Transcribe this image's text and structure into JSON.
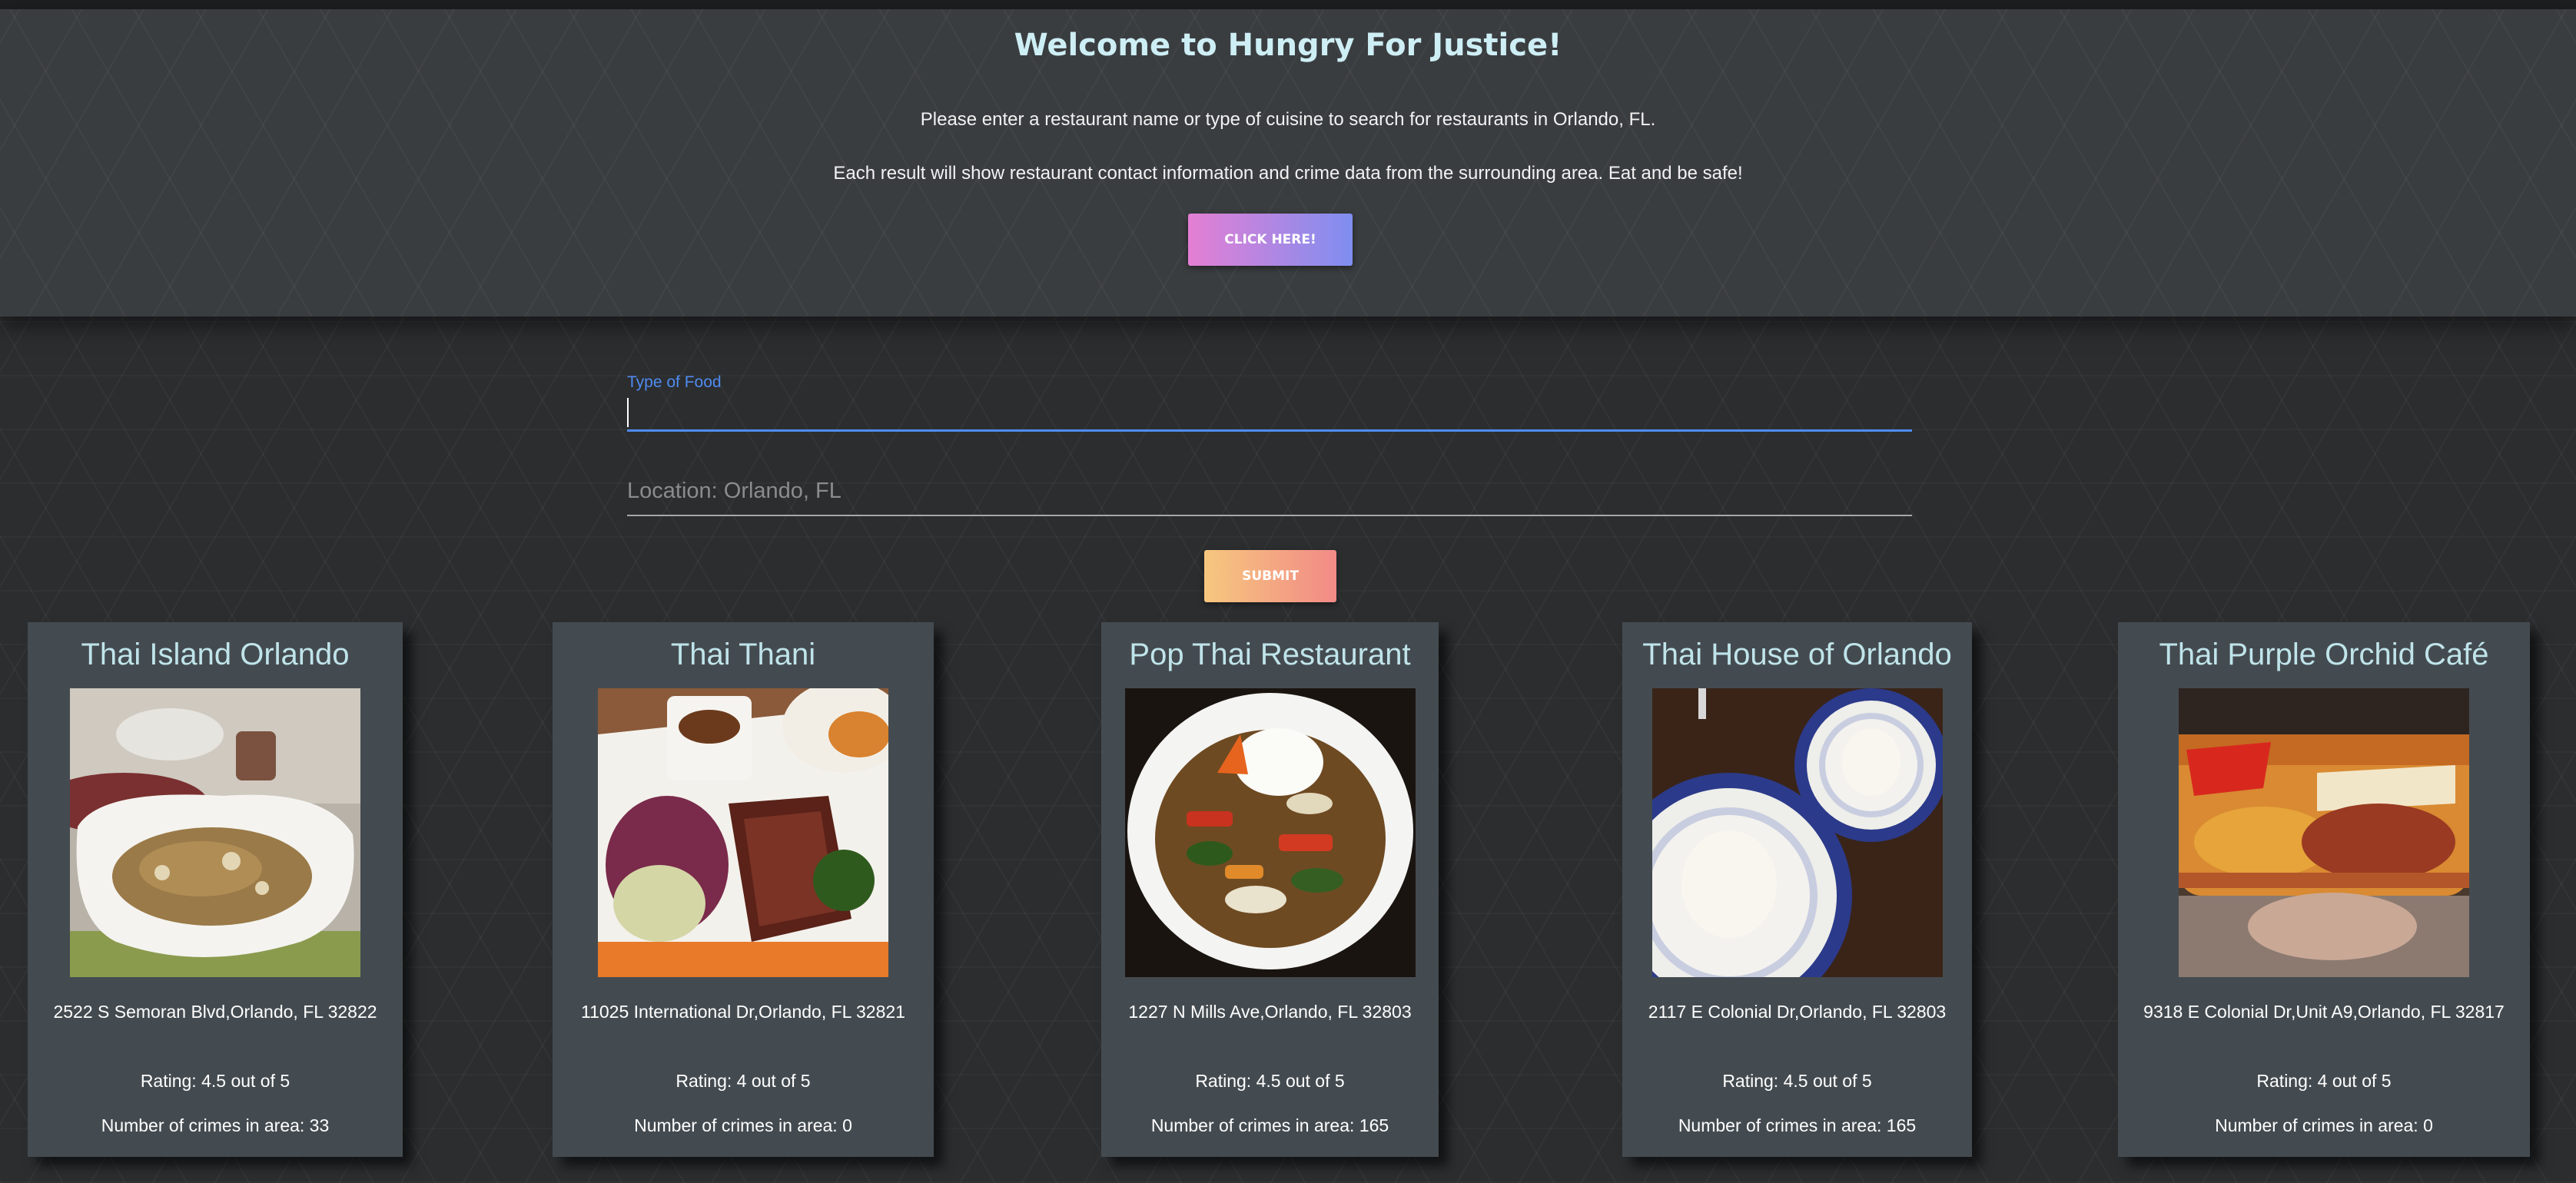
{
  "hero": {
    "title": "Welcome to Hungry For Justice!",
    "intro": "Please enter a restaurant name or type of cuisine to search for restaurants in Orlando, FL.",
    "description": "Each result will show restaurant contact information and crime data from the surrounding area. Eat and be safe!",
    "button_label": "CLICK HERE!"
  },
  "search": {
    "food_label": "Type of Food",
    "food_value": "",
    "location_placeholder": "Location: Orlando, FL",
    "location_value": "",
    "submit_label": "SUBMIT"
  },
  "colors": {
    "title_accent": "#cdeef4",
    "input_focus": "#4f8bf0",
    "card_background": "#444b50",
    "card_title": "#bfe4ea"
  },
  "results": [
    {
      "name": "Thai Island Orlando",
      "address": "2522 S Semoran Blvd,Orlando, FL 32822",
      "rating": "Rating: 4.5 out of 5",
      "crimes": "Number of crimes in area: 33"
    },
    {
      "name": "Thai Thani",
      "address": "11025 International Dr,Orlando, FL 32821",
      "rating": "Rating: 4 out of 5",
      "crimes": "Number of crimes in area: 0"
    },
    {
      "name": "Pop Thai Restaurant",
      "address": "1227 N Mills Ave,Orlando, FL 32803",
      "rating": "Rating: 4.5 out of 5",
      "crimes": "Number of crimes in area: 165"
    },
    {
      "name": "Thai House of Orlando",
      "address": "2117 E Colonial Dr,Orlando, FL 32803",
      "rating": "Rating: 4.5 out of 5",
      "crimes": "Number of crimes in area: 165"
    },
    {
      "name": "Thai Purple Orchid Café",
      "address": "9318 E Colonial Dr,Unit A9,Orlando, FL 32817",
      "rating": "Rating: 4 out of 5",
      "crimes": "Number of crimes in area: 0"
    }
  ]
}
